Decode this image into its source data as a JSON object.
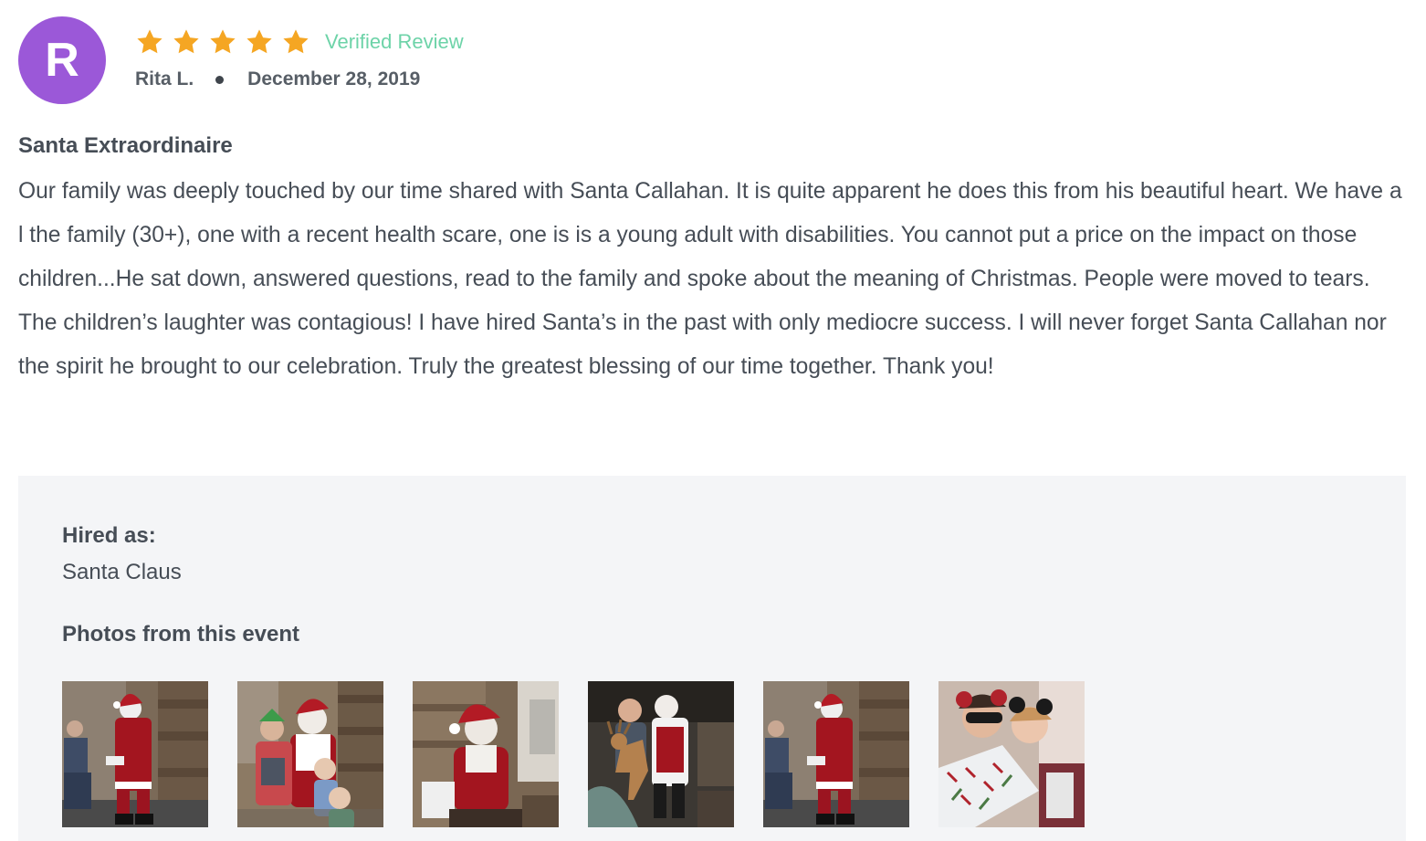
{
  "review": {
    "avatar_initial": "R",
    "rating": 5,
    "rating_max": 5,
    "verified_label": "Verified Review",
    "reviewer_name": "Rita L.",
    "date": "December 28, 2019",
    "title": "Santa Extraordinaire",
    "body": "Our family was deeply touched by our time shared with Santa Callahan. It is quite apparent he does this from his beautiful heart. We have a l the family (30+), one with a recent health scare, one is is a young adult with disabilities. You cannot put a price on the impact on those children...He sat down, answered questions, read to the family and spoke about the meaning of Christmas. People were moved to tears. The children’s laughter was contagious! I have hired Santa’s in the past with only mediocre success. I will never forget Santa Callahan nor the spirit he brought to our celebration. Truly the greatest blessing of our time together. Thank you!"
  },
  "details": {
    "hired_as_label": "Hired as:",
    "hired_as_value": "Santa Claus",
    "photos_label": "Photos from this event",
    "photo_count": 6
  },
  "colors": {
    "avatar_bg": "#9b58d8",
    "star": "#f5a623",
    "verified": "#6dd3a8",
    "text": "#464d56",
    "panel_bg": "#f4f5f7"
  },
  "icons": {
    "star": "star-icon"
  }
}
